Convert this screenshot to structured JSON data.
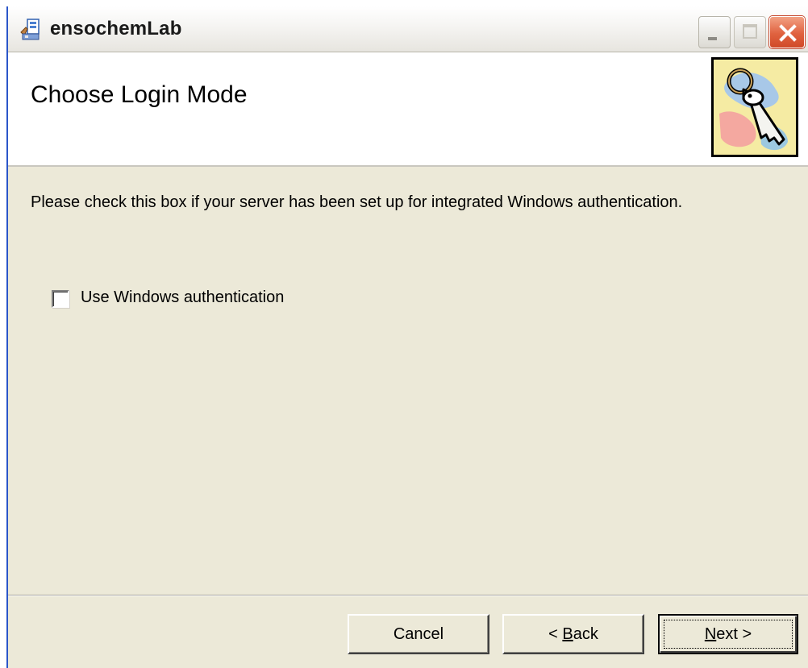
{
  "window": {
    "title": "ensochemLab",
    "controls": {
      "minimize": "minimize-icon",
      "maximize": "maximize-icon",
      "close": "close-icon"
    }
  },
  "header": {
    "title": "Choose Login Mode",
    "art_icon": "key-icon"
  },
  "body": {
    "instruction": "Please check this box if your server has been set up for integrated Windows authentication.",
    "checkbox": {
      "label": "Use Windows authentication",
      "checked": false
    }
  },
  "buttons": {
    "cancel": "Cancel",
    "back_prefix": "< ",
    "back_accel": "B",
    "back_rest": "ack",
    "next_accel": "N",
    "next_rest": "ext >"
  },
  "colors": {
    "dialog_bg": "#ece9d8",
    "close_button": "#e0623f",
    "border_blue": "#2b56c9",
    "art_bg": "#f5eba3"
  }
}
